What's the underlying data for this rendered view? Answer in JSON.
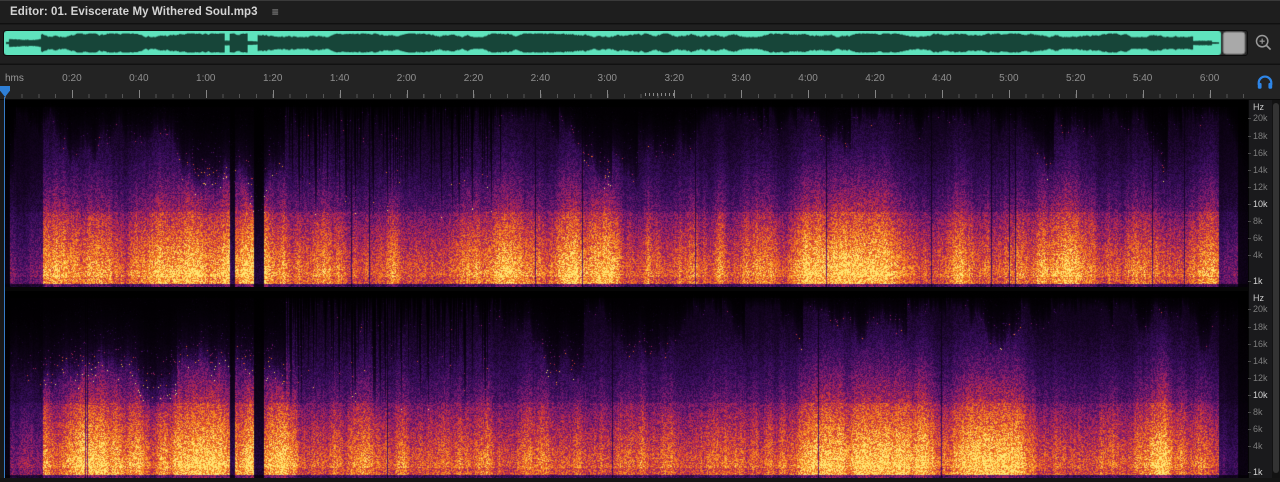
{
  "titlebar": {
    "title": "Editor: 01. Eviscerate My Withered Soul.mp3",
    "menu_icon": "≡"
  },
  "overview": {
    "waveform_color": "#5fe3bd",
    "waveform_dark": "#0e2f27",
    "strip_bg": "#262626",
    "handle_color": "#a9a9a9",
    "zoom_icon_name": "zoom-navigate-icon"
  },
  "timeline": {
    "unit_label": "hms",
    "tick_interval_seconds": 20,
    "tick_labels": [
      "0:20",
      "0:40",
      "1:00",
      "1:20",
      "1:40",
      "2:00",
      "2:20",
      "2:40",
      "3:00",
      "3:20",
      "3:40",
      "4:00",
      "4:20",
      "4:40",
      "5:00",
      "5:20",
      "5:40",
      "6:00"
    ],
    "accent_color": "#2e7fd6",
    "right_icon_name": "headphones-icon"
  },
  "spectrogram": {
    "hz_label": "Hz",
    "channels": [
      "channel-1",
      "channel-2"
    ],
    "freq_labels": [
      {
        "label": "20k",
        "y_frac": 0.096,
        "bright": false
      },
      {
        "label": "18k",
        "y_frac": 0.193,
        "bright": false
      },
      {
        "label": "16k",
        "y_frac": 0.283,
        "bright": false
      },
      {
        "label": "14k",
        "y_frac": 0.374,
        "bright": false
      },
      {
        "label": "12k",
        "y_frac": 0.465,
        "bright": false
      },
      {
        "label": "10k",
        "y_frac": 0.556,
        "bright": true
      },
      {
        "label": "8k",
        "y_frac": 0.647,
        "bright": false
      },
      {
        "label": "6k",
        "y_frac": 0.738,
        "bright": false
      },
      {
        "label": "4k",
        "y_frac": 0.829,
        "bright": false
      },
      {
        "label": "1k",
        "y_frac": 0.968,
        "bright": true
      }
    ],
    "colormap": [
      {
        "t": 0.0,
        "c": "#000000"
      },
      {
        "t": 0.16,
        "c": "#150423"
      },
      {
        "t": 0.32,
        "c": "#3c0f63"
      },
      {
        "t": 0.46,
        "c": "#8a1d6e"
      },
      {
        "t": 0.58,
        "c": "#c62f3f"
      },
      {
        "t": 0.72,
        "c": "#ee6a1f"
      },
      {
        "t": 0.86,
        "c": "#fba32a"
      },
      {
        "t": 1.0,
        "c": "#ffe873"
      }
    ]
  }
}
